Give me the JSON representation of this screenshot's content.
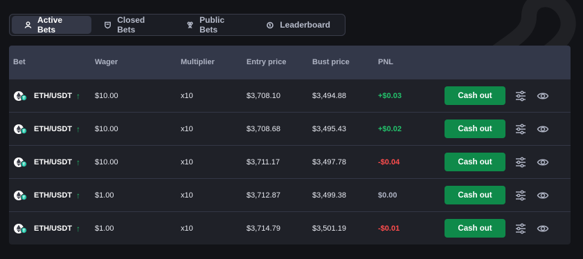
{
  "tabs": [
    {
      "label": "Active Bets",
      "icon": "user-icon",
      "active": true
    },
    {
      "label": "Closed Bets",
      "icon": "shield-icon",
      "active": false
    },
    {
      "label": "Public Bets",
      "icon": "users-icon",
      "active": false
    },
    {
      "label": "Leaderboard",
      "icon": "medal-icon",
      "active": false
    }
  ],
  "columns": {
    "bet": "Bet",
    "wager": "Wager",
    "multiplier": "Multiplier",
    "entry": "Entry price",
    "bust": "Bust price",
    "pnl": "PNL"
  },
  "rows": [
    {
      "pair": "ETH/USDT",
      "arrow": "↑",
      "wager": "$10.00",
      "multiplier": "x10",
      "entry": "$3,708.10",
      "bust": "$3,494.88",
      "pnl": "+$0.03",
      "pnl_status": "positive",
      "action": "Cash out"
    },
    {
      "pair": "ETH/USDT",
      "arrow": "↑",
      "wager": "$10.00",
      "multiplier": "x10",
      "entry": "$3,708.68",
      "bust": "$3,495.43",
      "pnl": "+$0.02",
      "pnl_status": "positive",
      "action": "Cash out"
    },
    {
      "pair": "ETH/USDT",
      "arrow": "↑",
      "wager": "$10.00",
      "multiplier": "x10",
      "entry": "$3,711.17",
      "bust": "$3,497.78",
      "pnl": "-$0.04",
      "pnl_status": "negative",
      "action": "Cash out"
    },
    {
      "pair": "ETH/USDT",
      "arrow": "↑",
      "wager": "$1.00",
      "multiplier": "x10",
      "entry": "$3,712.87",
      "bust": "$3,499.38",
      "pnl": "$0.00",
      "pnl_status": "neutral",
      "action": "Cash out"
    },
    {
      "pair": "ETH/USDT",
      "arrow": "↑",
      "wager": "$1.00",
      "multiplier": "x10",
      "entry": "$3,714.79",
      "bust": "$3,501.19",
      "pnl": "-$0.01",
      "pnl_status": "negative",
      "action": "Cash out"
    }
  ],
  "colors": {
    "accent_green": "#0f8a4a",
    "positive": "#23c26b",
    "negative": "#ff4d4d",
    "background": "#121317",
    "header": "#333849"
  }
}
